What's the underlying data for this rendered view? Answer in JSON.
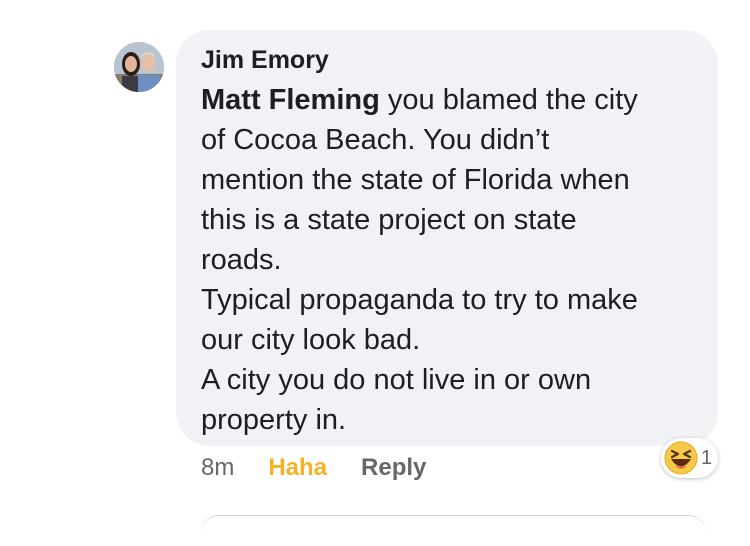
{
  "comment": {
    "author": "Jim Emory",
    "mention": "Matt Fleming",
    "lines": [
      " you blamed the city",
      "of Cocoa Beach. You didn’t",
      "mention the state of Florida when",
      "this is a state project on state",
      "roads.",
      "Typical propaganda to try to make",
      "our city look bad.",
      "A city you do not live in or own",
      "property in."
    ],
    "timestamp": "8m",
    "reaction_label": "Haha",
    "reply_label": "Reply",
    "reaction": {
      "icon": "haha-emoji-icon",
      "count": "1"
    }
  },
  "colors": {
    "bubble": "#f0f2f5",
    "haha": "#f7b125",
    "muted": "#65676b",
    "text": "#1c1e21"
  }
}
